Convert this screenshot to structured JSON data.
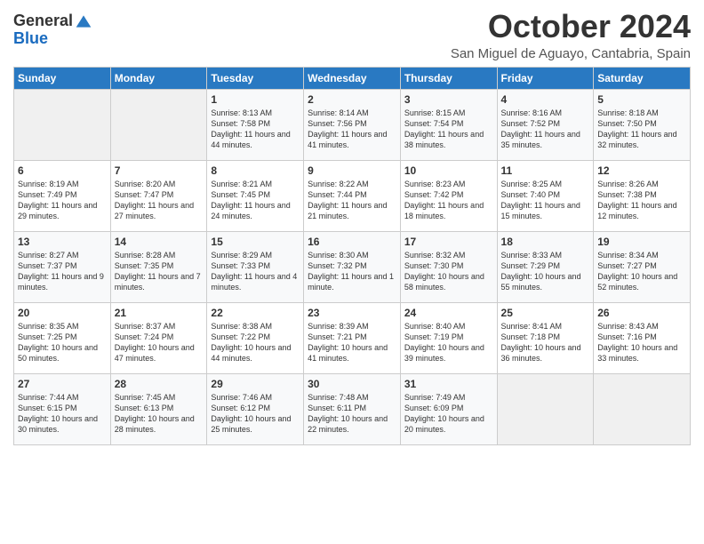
{
  "header": {
    "logo_general": "General",
    "logo_blue": "Blue",
    "month_title": "October 2024",
    "subtitle": "San Miguel de Aguayo, Cantabria, Spain"
  },
  "weekdays": [
    "Sunday",
    "Monday",
    "Tuesday",
    "Wednesday",
    "Thursday",
    "Friday",
    "Saturday"
  ],
  "weeks": [
    [
      {
        "day": "",
        "empty": true
      },
      {
        "day": "",
        "empty": true
      },
      {
        "day": "1",
        "sunrise": "Sunrise: 8:13 AM",
        "sunset": "Sunset: 7:58 PM",
        "daylight": "Daylight: 11 hours and 44 minutes."
      },
      {
        "day": "2",
        "sunrise": "Sunrise: 8:14 AM",
        "sunset": "Sunset: 7:56 PM",
        "daylight": "Daylight: 11 hours and 41 minutes."
      },
      {
        "day": "3",
        "sunrise": "Sunrise: 8:15 AM",
        "sunset": "Sunset: 7:54 PM",
        "daylight": "Daylight: 11 hours and 38 minutes."
      },
      {
        "day": "4",
        "sunrise": "Sunrise: 8:16 AM",
        "sunset": "Sunset: 7:52 PM",
        "daylight": "Daylight: 11 hours and 35 minutes."
      },
      {
        "day": "5",
        "sunrise": "Sunrise: 8:18 AM",
        "sunset": "Sunset: 7:50 PM",
        "daylight": "Daylight: 11 hours and 32 minutes."
      }
    ],
    [
      {
        "day": "6",
        "sunrise": "Sunrise: 8:19 AM",
        "sunset": "Sunset: 7:49 PM",
        "daylight": "Daylight: 11 hours and 29 minutes."
      },
      {
        "day": "7",
        "sunrise": "Sunrise: 8:20 AM",
        "sunset": "Sunset: 7:47 PM",
        "daylight": "Daylight: 11 hours and 27 minutes."
      },
      {
        "day": "8",
        "sunrise": "Sunrise: 8:21 AM",
        "sunset": "Sunset: 7:45 PM",
        "daylight": "Daylight: 11 hours and 24 minutes."
      },
      {
        "day": "9",
        "sunrise": "Sunrise: 8:22 AM",
        "sunset": "Sunset: 7:44 PM",
        "daylight": "Daylight: 11 hours and 21 minutes."
      },
      {
        "day": "10",
        "sunrise": "Sunrise: 8:23 AM",
        "sunset": "Sunset: 7:42 PM",
        "daylight": "Daylight: 11 hours and 18 minutes."
      },
      {
        "day": "11",
        "sunrise": "Sunrise: 8:25 AM",
        "sunset": "Sunset: 7:40 PM",
        "daylight": "Daylight: 11 hours and 15 minutes."
      },
      {
        "day": "12",
        "sunrise": "Sunrise: 8:26 AM",
        "sunset": "Sunset: 7:38 PM",
        "daylight": "Daylight: 11 hours and 12 minutes."
      }
    ],
    [
      {
        "day": "13",
        "sunrise": "Sunrise: 8:27 AM",
        "sunset": "Sunset: 7:37 PM",
        "daylight": "Daylight: 11 hours and 9 minutes."
      },
      {
        "day": "14",
        "sunrise": "Sunrise: 8:28 AM",
        "sunset": "Sunset: 7:35 PM",
        "daylight": "Daylight: 11 hours and 7 minutes."
      },
      {
        "day": "15",
        "sunrise": "Sunrise: 8:29 AM",
        "sunset": "Sunset: 7:33 PM",
        "daylight": "Daylight: 11 hours and 4 minutes."
      },
      {
        "day": "16",
        "sunrise": "Sunrise: 8:30 AM",
        "sunset": "Sunset: 7:32 PM",
        "daylight": "Daylight: 11 hours and 1 minute."
      },
      {
        "day": "17",
        "sunrise": "Sunrise: 8:32 AM",
        "sunset": "Sunset: 7:30 PM",
        "daylight": "Daylight: 10 hours and 58 minutes."
      },
      {
        "day": "18",
        "sunrise": "Sunrise: 8:33 AM",
        "sunset": "Sunset: 7:29 PM",
        "daylight": "Daylight: 10 hours and 55 minutes."
      },
      {
        "day": "19",
        "sunrise": "Sunrise: 8:34 AM",
        "sunset": "Sunset: 7:27 PM",
        "daylight": "Daylight: 10 hours and 52 minutes."
      }
    ],
    [
      {
        "day": "20",
        "sunrise": "Sunrise: 8:35 AM",
        "sunset": "Sunset: 7:25 PM",
        "daylight": "Daylight: 10 hours and 50 minutes."
      },
      {
        "day": "21",
        "sunrise": "Sunrise: 8:37 AM",
        "sunset": "Sunset: 7:24 PM",
        "daylight": "Daylight: 10 hours and 47 minutes."
      },
      {
        "day": "22",
        "sunrise": "Sunrise: 8:38 AM",
        "sunset": "Sunset: 7:22 PM",
        "daylight": "Daylight: 10 hours and 44 minutes."
      },
      {
        "day": "23",
        "sunrise": "Sunrise: 8:39 AM",
        "sunset": "Sunset: 7:21 PM",
        "daylight": "Daylight: 10 hours and 41 minutes."
      },
      {
        "day": "24",
        "sunrise": "Sunrise: 8:40 AM",
        "sunset": "Sunset: 7:19 PM",
        "daylight": "Daylight: 10 hours and 39 minutes."
      },
      {
        "day": "25",
        "sunrise": "Sunrise: 8:41 AM",
        "sunset": "Sunset: 7:18 PM",
        "daylight": "Daylight: 10 hours and 36 minutes."
      },
      {
        "day": "26",
        "sunrise": "Sunrise: 8:43 AM",
        "sunset": "Sunset: 7:16 PM",
        "daylight": "Daylight: 10 hours and 33 minutes."
      }
    ],
    [
      {
        "day": "27",
        "sunrise": "Sunrise: 7:44 AM",
        "sunset": "Sunset: 6:15 PM",
        "daylight": "Daylight: 10 hours and 30 minutes."
      },
      {
        "day": "28",
        "sunrise": "Sunrise: 7:45 AM",
        "sunset": "Sunset: 6:13 PM",
        "daylight": "Daylight: 10 hours and 28 minutes."
      },
      {
        "day": "29",
        "sunrise": "Sunrise: 7:46 AM",
        "sunset": "Sunset: 6:12 PM",
        "daylight": "Daylight: 10 hours and 25 minutes."
      },
      {
        "day": "30",
        "sunrise": "Sunrise: 7:48 AM",
        "sunset": "Sunset: 6:11 PM",
        "daylight": "Daylight: 10 hours and 22 minutes."
      },
      {
        "day": "31",
        "sunrise": "Sunrise: 7:49 AM",
        "sunset": "Sunset: 6:09 PM",
        "daylight": "Daylight: 10 hours and 20 minutes."
      },
      {
        "day": "",
        "empty": true
      },
      {
        "day": "",
        "empty": true
      }
    ]
  ]
}
